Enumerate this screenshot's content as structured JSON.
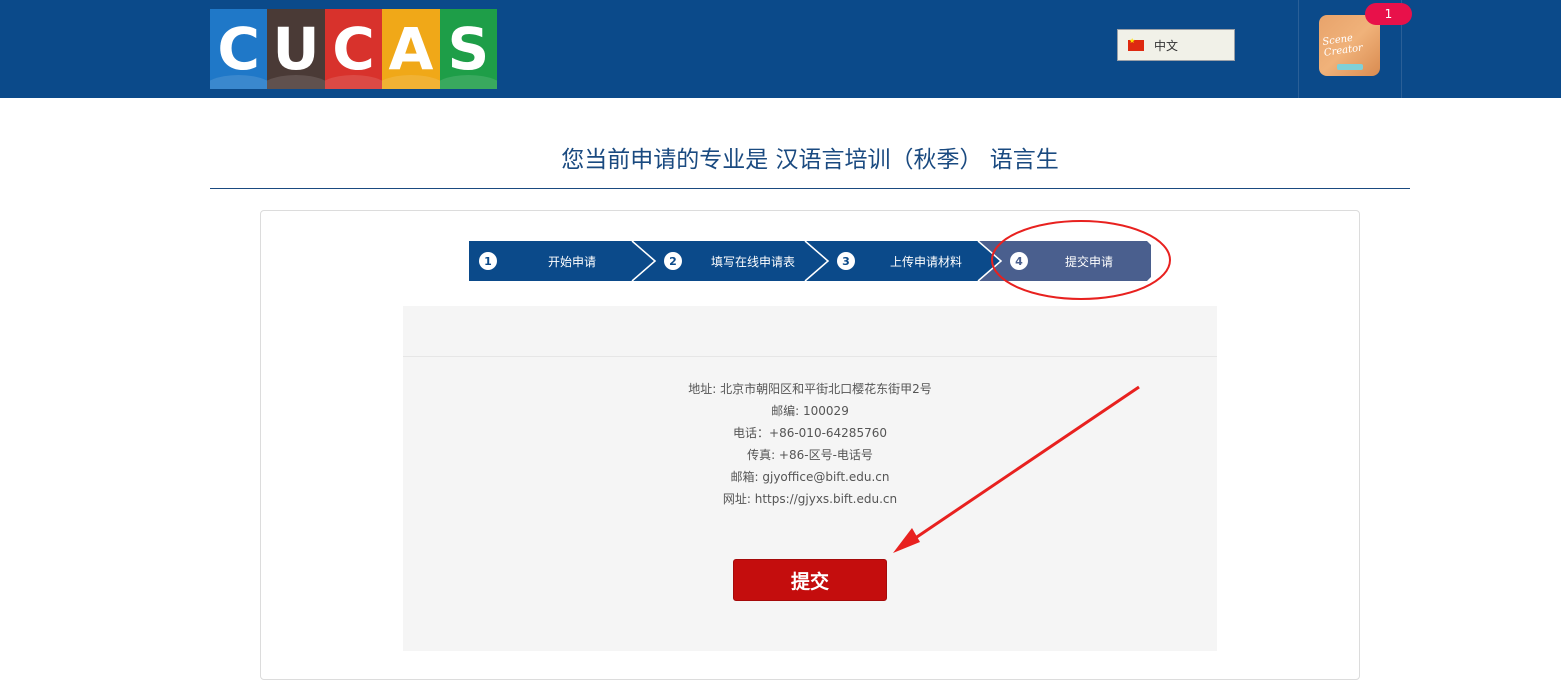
{
  "header": {
    "logo_letters": [
      "C",
      "U",
      "C",
      "A",
      "S"
    ],
    "language": "中文",
    "notification_count": "1",
    "avatar_text": "Scene Creator"
  },
  "page_title": "您当前申请的专业是 汉语言培训（秋季） 语言生",
  "steps": [
    {
      "num": "1",
      "label": "开始申请"
    },
    {
      "num": "2",
      "label": "填写在线申请表"
    },
    {
      "num": "3",
      "label": "上传申请材料"
    },
    {
      "num": "4",
      "label": "提交申请"
    }
  ],
  "contact": {
    "address": "地址: 北京市朝阳区和平街北口樱花东街甲2号",
    "postcode": "邮编: 100029",
    "phone": "电话：+86-010-64285760",
    "fax": "传真: +86-区号-电话号",
    "email": "邮箱: gjyoffice@bift.edu.cn",
    "website": "网址: https://gjyxs.bift.edu.cn"
  },
  "submit_label": "提交",
  "colors": {
    "header_bg": "#0b4a8a",
    "step_done": "#0b4a8a",
    "step_active": "#4a5f8e",
    "submit_bg": "#c40d0d",
    "annotation": "#e8211f"
  }
}
